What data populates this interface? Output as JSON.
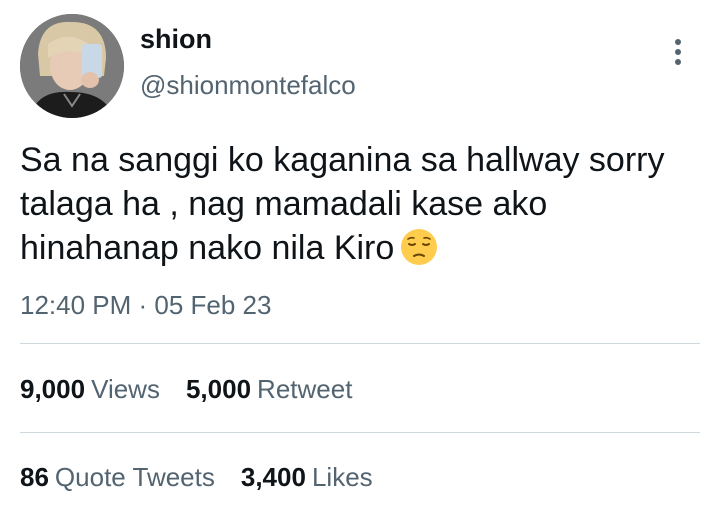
{
  "user": {
    "display_name": "shion",
    "handle": "@shionmontefalco"
  },
  "tweet": {
    "text": "Sa na sanggi ko kaganina sa hallway sorry talaga ha , nag mamadali kase ako hinahanap nako nila Kiro",
    "emoji": "pensive-face-emoji",
    "timestamp": "12:40 PM · 05 Feb 23"
  },
  "stats": {
    "views": {
      "count": "9,000",
      "label": "Views"
    },
    "retweets": {
      "count": "5,000",
      "label": "Retweet"
    },
    "quotes": {
      "count": "86",
      "label": "Quote Tweets"
    },
    "likes": {
      "count": "3,400",
      "label": "Likes"
    }
  },
  "icons": {
    "more": "more-vertical-icon"
  },
  "colors": {
    "text_primary": "#0f1419",
    "text_secondary": "#536471",
    "divider": "#cfd9de"
  }
}
